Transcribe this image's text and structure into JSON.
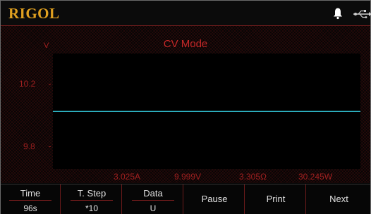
{
  "brand": "RIGOL",
  "status_icons": [
    "bell-icon",
    "usb-icon"
  ],
  "main": {
    "mode_title": "CV Mode",
    "unit": "V",
    "y_ticks": [
      "10.2",
      "9.8"
    ],
    "readings": {
      "current": "3.025A",
      "voltage": "9.999V",
      "resistance": "3.305Ω",
      "power": "30.245W"
    }
  },
  "chart_data": {
    "type": "line",
    "title": "CV Mode",
    "ylabel": "V",
    "y_ticks": [
      10.2,
      9.8
    ],
    "ylim": [
      9.7,
      10.3
    ],
    "series": [
      {
        "values": [
          9.999,
          9.999
        ]
      }
    ],
    "grid": false
  },
  "softkeys": [
    {
      "label": "Time",
      "value": "96s"
    },
    {
      "label": "T. Step",
      "value": "*10"
    },
    {
      "label": "Data",
      "value": "U"
    },
    {
      "label": "Pause"
    },
    {
      "label": "Print"
    },
    {
      "label": "Next"
    }
  ],
  "colors": {
    "brand": "#e0a020",
    "accent_red": "#c42828",
    "trace": "#2fb8c8"
  }
}
